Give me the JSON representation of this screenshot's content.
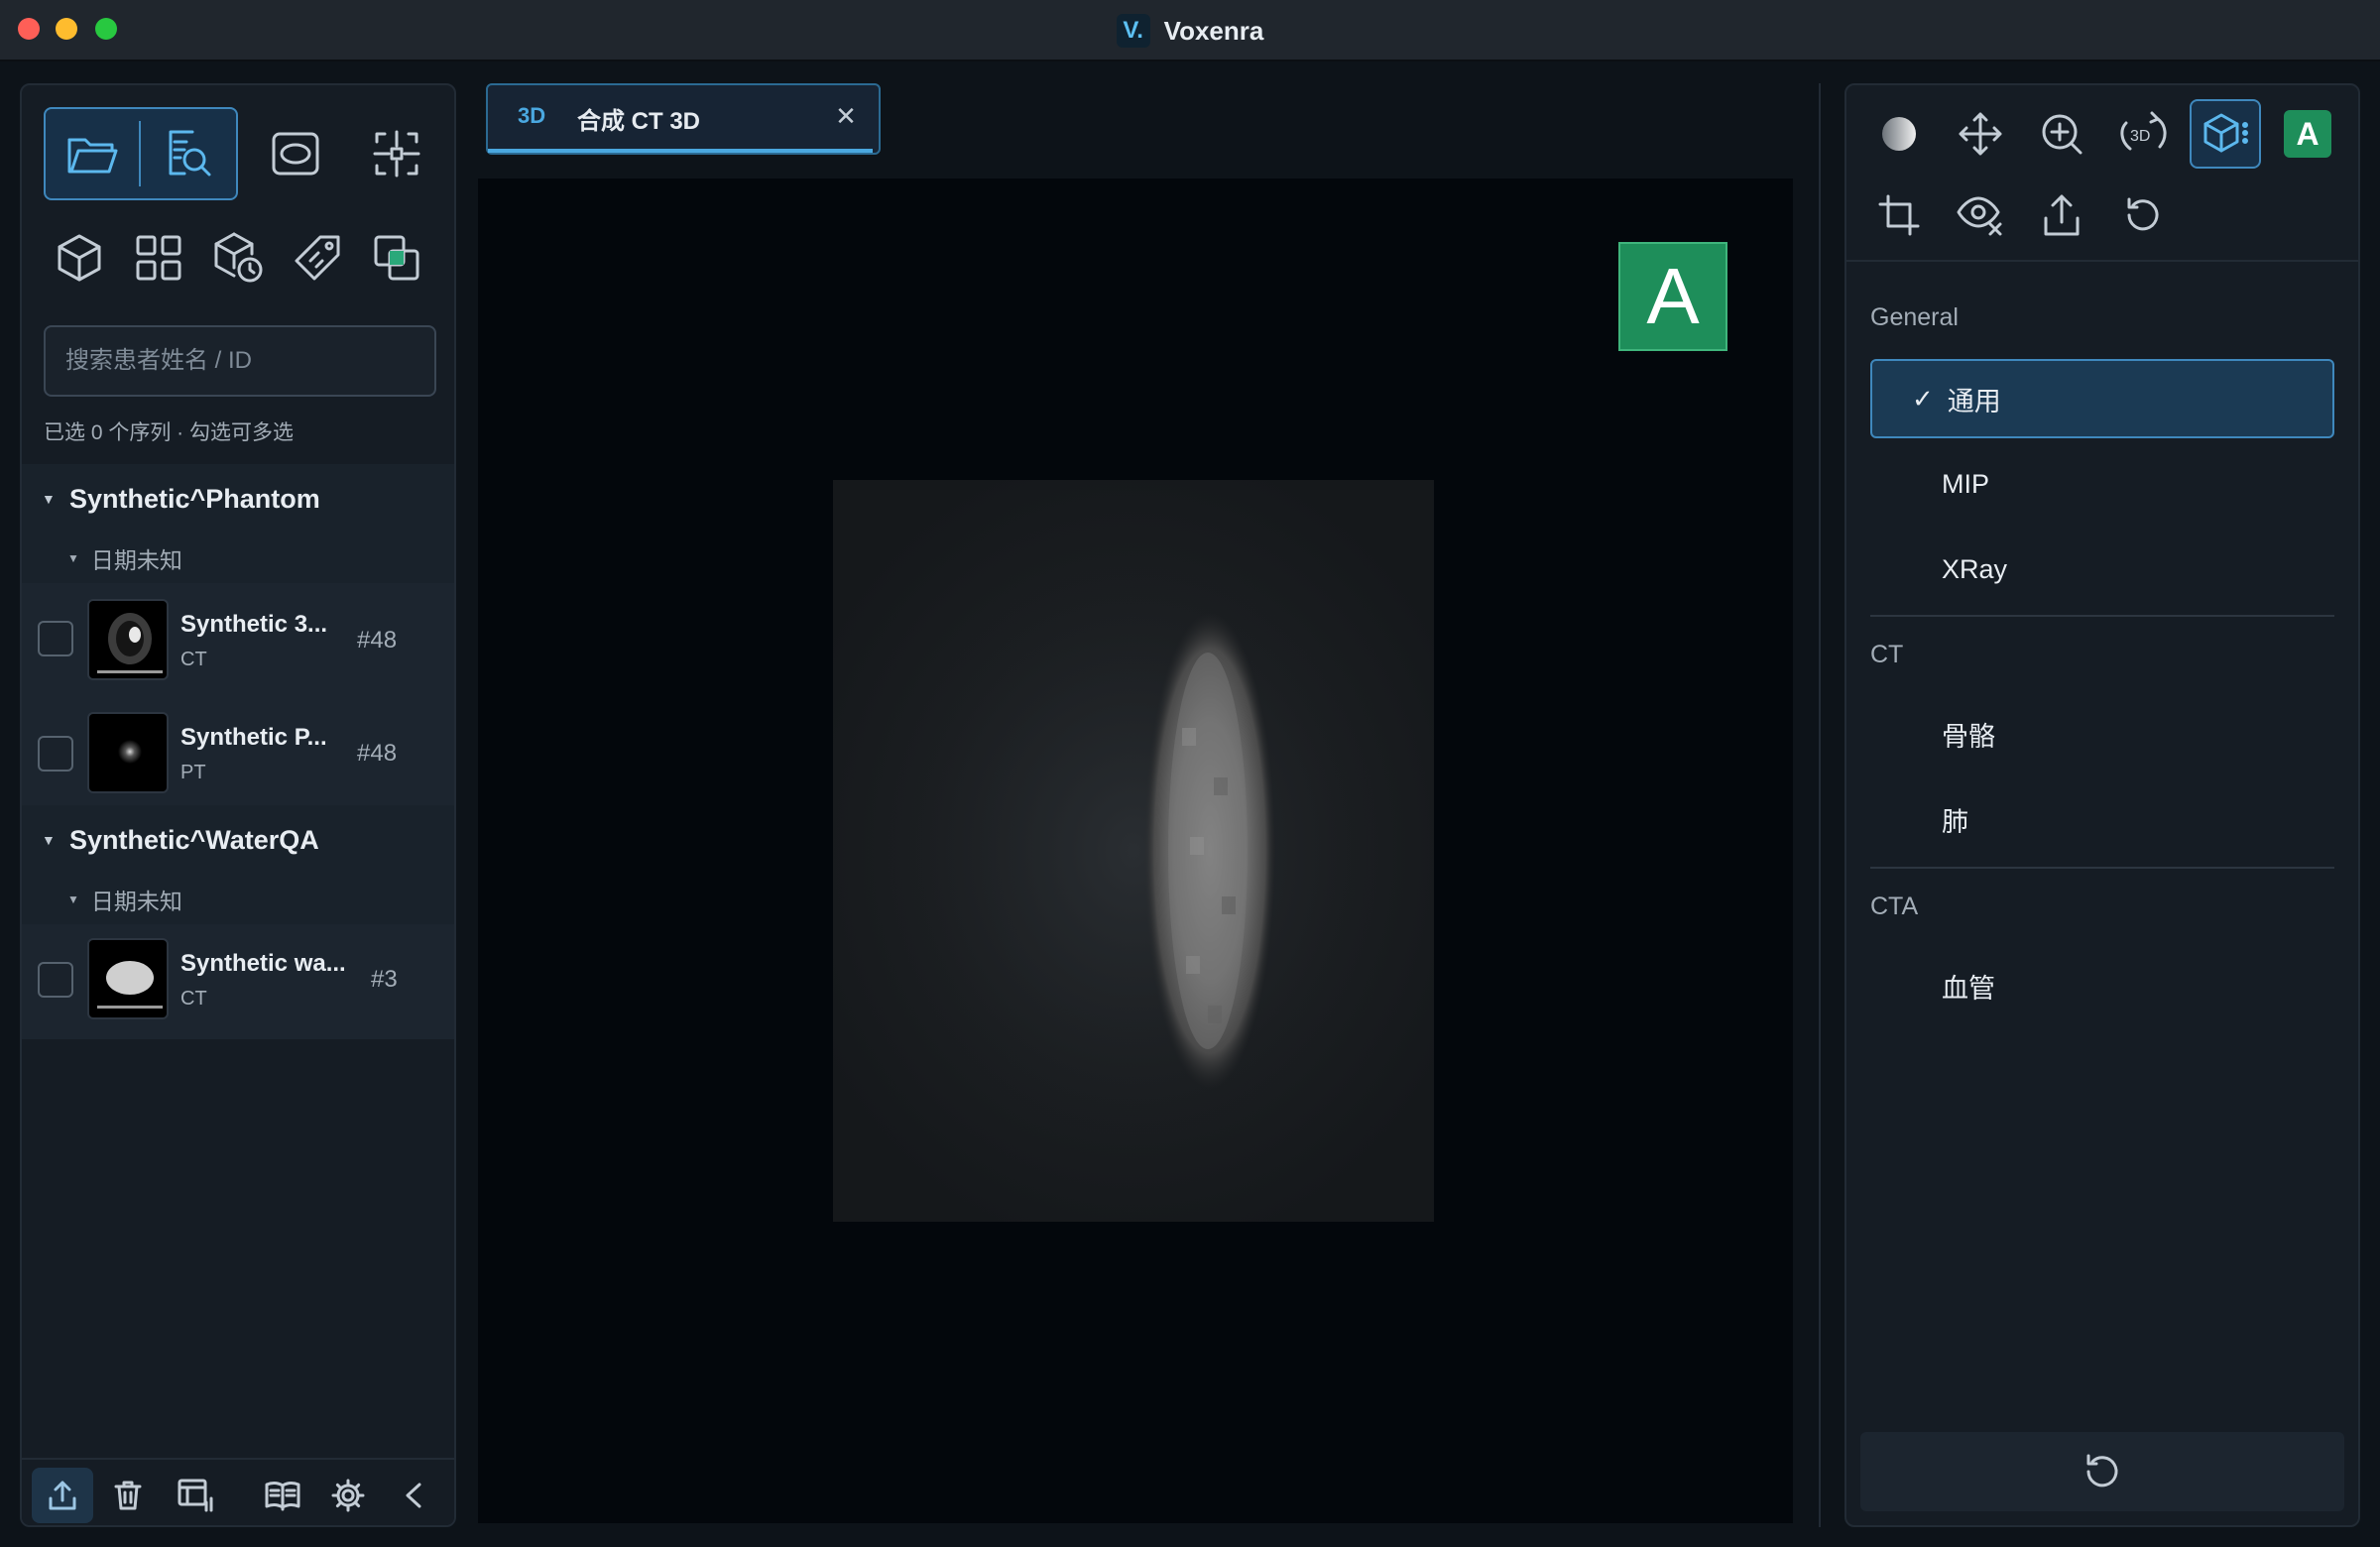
{
  "window": {
    "title": "Voxenra",
    "logo_letter": "V.",
    "traffic_lights": [
      "#fe5f57",
      "#febc2e",
      "#28c840"
    ]
  },
  "left_panel": {
    "top_buttons": [
      {
        "icon": "folder-open-icon",
        "active": true
      },
      {
        "icon": "search-document-icon",
        "active": true
      },
      {
        "icon": "ellipse-roi-icon",
        "active": false
      },
      {
        "icon": "crosshair-layout-icon",
        "active": false
      }
    ],
    "second_row_icons": [
      "cube-icon",
      "grid-icon",
      "cube-clock-icon",
      "tag-icon",
      "layers-icon"
    ],
    "search": {
      "placeholder": "搜索患者姓名 / ID",
      "value": ""
    },
    "selection_hint": "已选 0 个序列 · 勾选可多选",
    "patients": [
      {
        "name": "Synthetic^Phantom",
        "date_group": "日期未知",
        "series": [
          {
            "title": "Synthetic 3...",
            "modality": "CT",
            "count": "#48",
            "checked": false,
            "thumb": "ct-phantom-thumbnail"
          },
          {
            "title": "Synthetic P...",
            "modality": "PT",
            "count": "#48",
            "checked": false,
            "thumb": "pt-dot-thumbnail"
          }
        ]
      },
      {
        "name": "Synthetic^WaterQA",
        "date_group": "日期未知",
        "series": [
          {
            "title": "Synthetic wa...",
            "modality": "CT",
            "count": "#3",
            "checked": false,
            "thumb": "water-ellipse-thumbnail"
          }
        ]
      }
    ],
    "bottom_icons": [
      "upload-icon",
      "trash-icon",
      "layout-table-icon",
      "book-icon",
      "gear-icon",
      "chevron-left-icon"
    ]
  },
  "viewer": {
    "tab": {
      "badge": "3D",
      "label": "合成 CT 3D",
      "close": "✕"
    },
    "orientation_marker": "A",
    "colors": {
      "accent": "#4aa8e0",
      "marker": "#1e8e5a"
    }
  },
  "right_panel": {
    "tool_row_1": [
      "contrast-icon",
      "pan-move-icon",
      "zoom-in-icon",
      "rotate-3d-icon",
      "volume-render-icon",
      "annotation-a-icon"
    ],
    "tool_row_2": [
      "crop-icon",
      "eye-hide-icon",
      "export-icon",
      "reset-rotate-icon"
    ],
    "annotation_letter": "A",
    "badge_3d": "3D",
    "groups": [
      {
        "label": "General",
        "presets": [
          {
            "label": "通用",
            "selected": true,
            "check": "✓"
          },
          {
            "label": "MIP",
            "selected": false
          },
          {
            "label": "XRay",
            "selected": false
          }
        ]
      },
      {
        "label": "CT",
        "presets": [
          {
            "label": "骨骼",
            "selected": false
          },
          {
            "label": "肺",
            "selected": false
          }
        ]
      },
      {
        "label": "CTA",
        "presets": [
          {
            "label": "血管",
            "selected": false
          }
        ]
      }
    ],
    "reset_icon": "reset-icon"
  }
}
